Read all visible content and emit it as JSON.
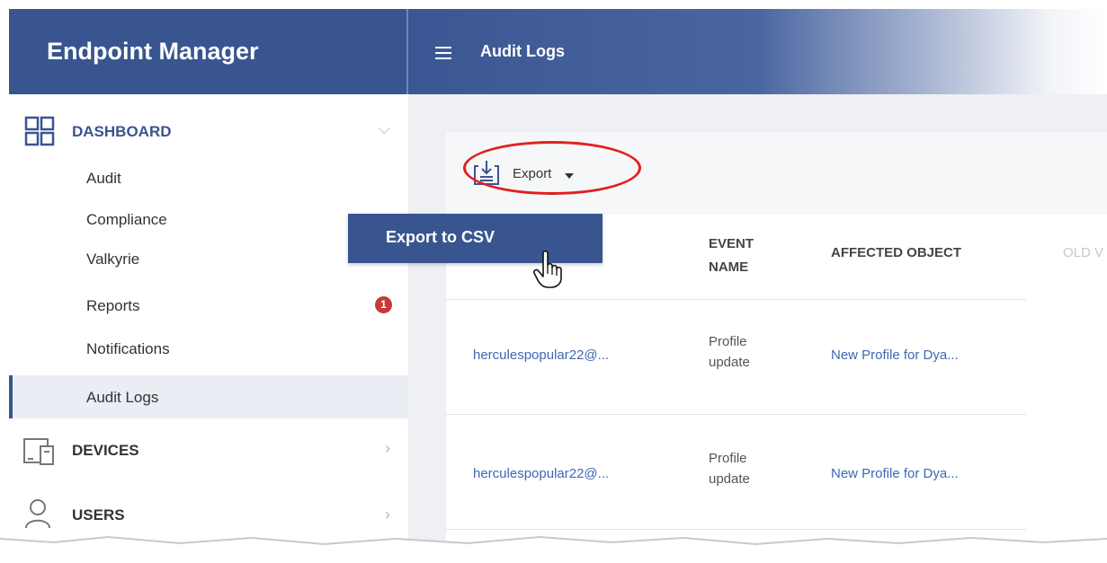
{
  "header": {
    "brand": "Endpoint Manager",
    "title": "Audit Logs"
  },
  "sidebar": {
    "dashboard": {
      "label": "DASHBOARD"
    },
    "items": [
      {
        "label": "Audit"
      },
      {
        "label": "Compliance"
      },
      {
        "label": "Valkyrie"
      },
      {
        "label": "Reports",
        "badge": "1"
      },
      {
        "label": "Notifications"
      },
      {
        "label": "Audit Logs",
        "active": true
      }
    ],
    "devices": {
      "label": "DEVICES"
    },
    "users": {
      "label": "USERS"
    }
  },
  "toolbar": {
    "export_label": "Export"
  },
  "dropdown": {
    "export_csv": "Export to CSV"
  },
  "table": {
    "columns": [
      "EVENT NAME",
      "AFFECTED OBJECT",
      "OLD V"
    ],
    "event_col": {
      "line1": "EVENT",
      "line2": "NAME"
    },
    "rows": [
      {
        "user": "herculespopular22@...",
        "event_line1": "Profile",
        "event_line2": "update",
        "object": "New Profile for Dya..."
      },
      {
        "user": "herculespopular22@...",
        "event_line1": "Profile",
        "event_line2": "update",
        "object": "New Profile for Dya..."
      }
    ]
  },
  "colors": {
    "brand": "#39558f",
    "link": "#3d68b3",
    "badge": "#c83a3a",
    "annotation": "#e02020"
  }
}
